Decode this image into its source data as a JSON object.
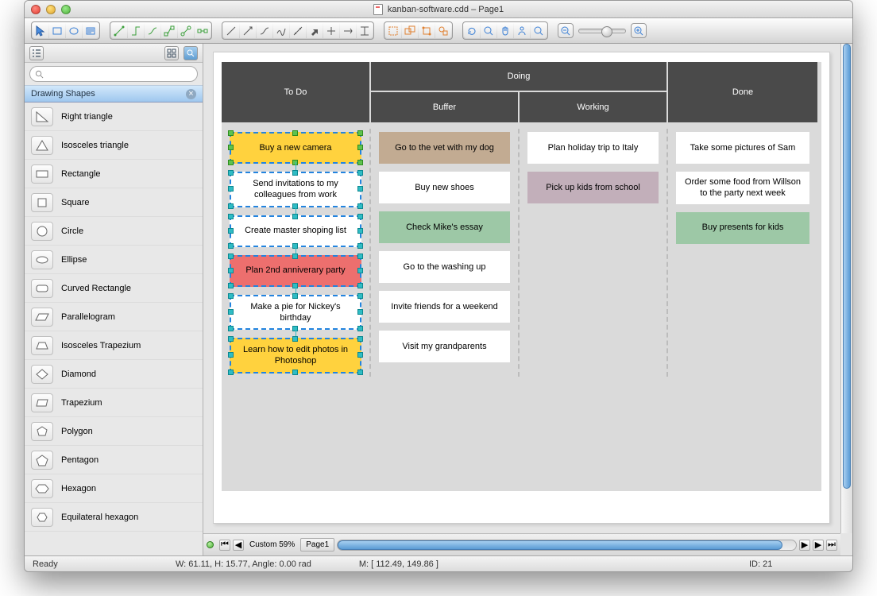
{
  "title": "kanban-software.cdd – Page1",
  "search_placeholder": "",
  "library_title": "Drawing Shapes",
  "shapes": [
    "Right triangle",
    "Isosceles triangle",
    "Rectangle",
    "Square",
    "Circle",
    "Ellipse",
    "Curved Rectangle",
    "Parallelogram",
    "Isosceles Trapezium",
    "Diamond",
    "Trapezium",
    "Polygon",
    "Pentagon",
    "Hexagon",
    "Equilateral hexagon"
  ],
  "kanban": {
    "todo_label": "To Do",
    "doing_label": "Doing",
    "buffer_label": "Buffer",
    "working_label": "Working",
    "done_label": "Done",
    "todo": [
      {
        "text": "Buy a new camera",
        "color": "yellow",
        "handles": "g"
      },
      {
        "text": "Send invitations to my colleagues from work",
        "color": "",
        "handles": "c"
      },
      {
        "text": "Create master shoping list",
        "color": "",
        "handles": "c"
      },
      {
        "text": "Plan 2nd anniverary party",
        "color": "red",
        "handles": "c"
      },
      {
        "text": "Make a pie for Nickey's birthday",
        "color": "",
        "handles": "c"
      },
      {
        "text": "Learn how to edit photos in Photoshop",
        "color": "yellow",
        "handles": "c"
      }
    ],
    "buffer": [
      {
        "text": "Go to the vet with my dog",
        "color": "tan"
      },
      {
        "text": "Buy new shoes",
        "color": ""
      },
      {
        "text": "Check Mike's essay",
        "color": "green"
      },
      {
        "text": "Go to the washing up",
        "color": ""
      },
      {
        "text": "Invite friends for a weekend",
        "color": ""
      },
      {
        "text": "Visit my grandparents",
        "color": ""
      }
    ],
    "working": [
      {
        "text": "Plan holiday trip to Italy",
        "color": ""
      },
      {
        "text": "Pick up kids from school",
        "color": "purple"
      }
    ],
    "done": [
      {
        "text": "Take some pictures of Sam",
        "color": ""
      },
      {
        "text": "Order some food from Willson to the party next week",
        "color": ""
      },
      {
        "text": "Buy presents for kids",
        "color": "green"
      }
    ]
  },
  "hscroll": {
    "page_tab": "Page1",
    "zoom_text": "Custom 59%"
  },
  "status": {
    "ready": "Ready",
    "size": "W: 61.11,  H: 15.77,  Angle: 0.00 rad",
    "mouse": "M: [ 112.49, 149.86 ]",
    "id": "ID: 21"
  }
}
